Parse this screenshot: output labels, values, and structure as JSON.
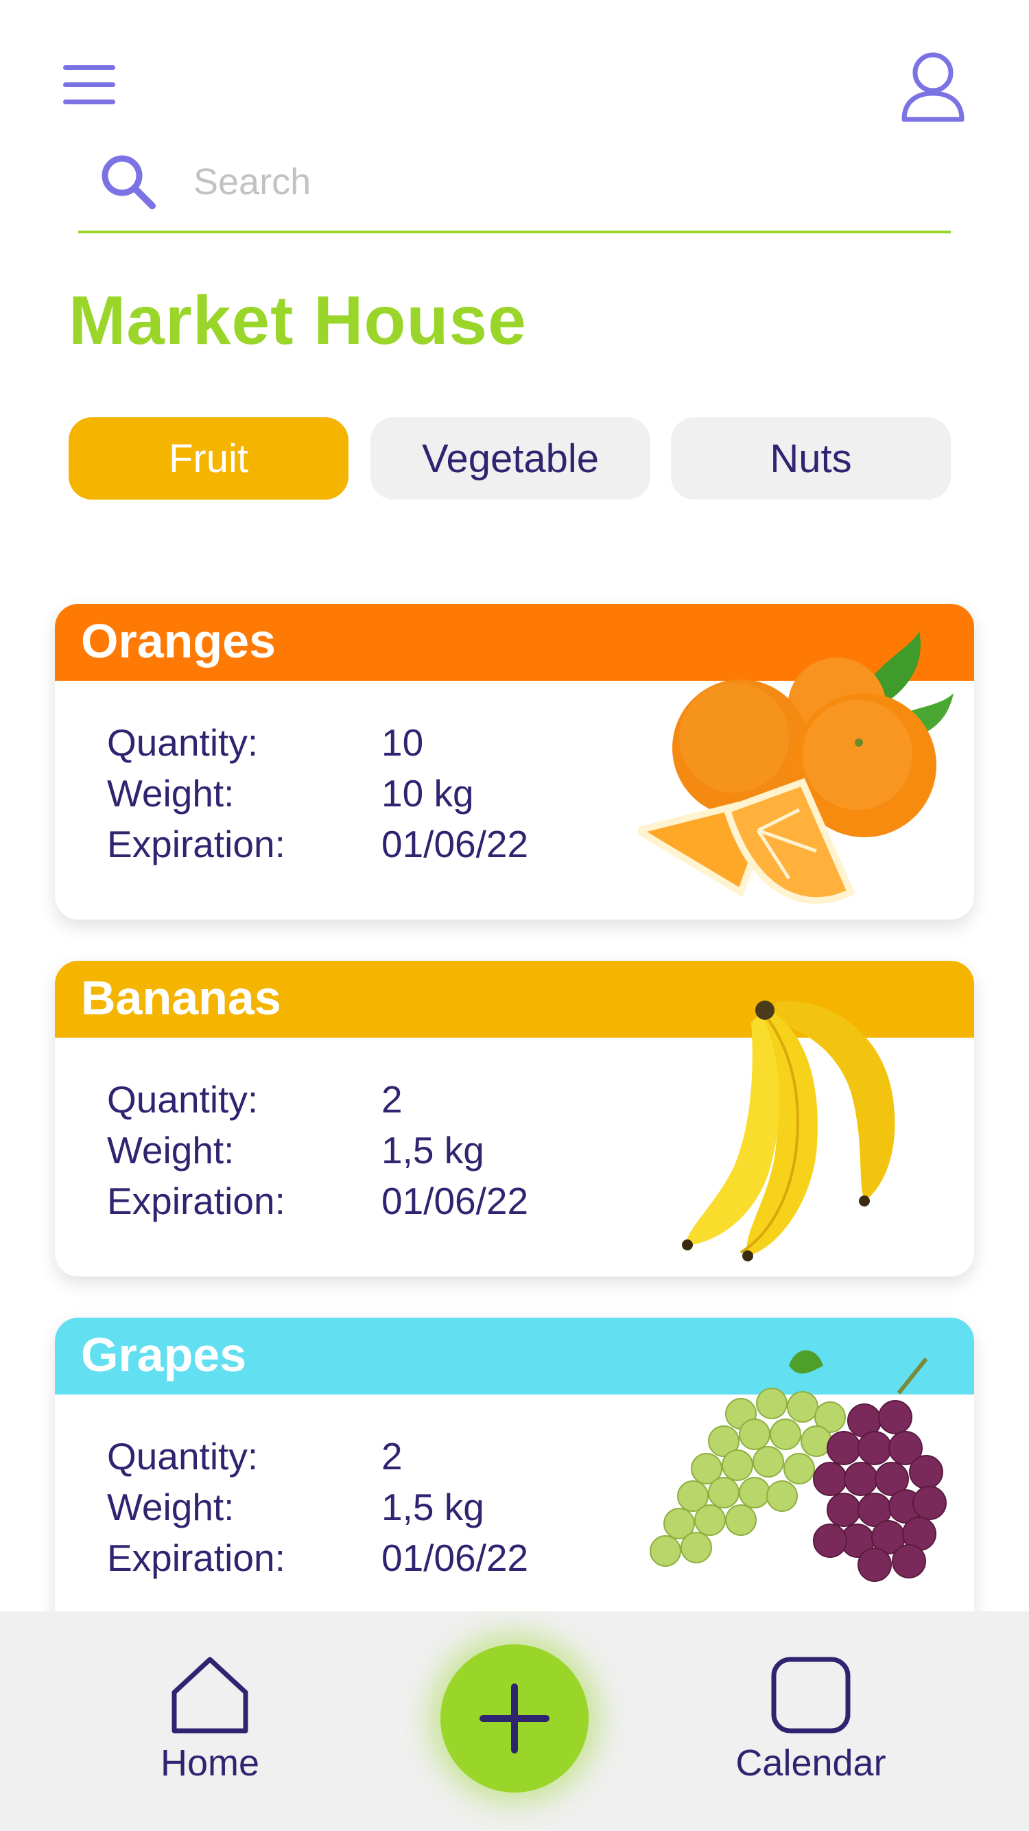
{
  "search": {
    "placeholder": "Search"
  },
  "page_title": "Market House",
  "tabs": [
    {
      "label": "Fruit",
      "active": true
    },
    {
      "label": "Vegetable",
      "active": false
    },
    {
      "label": "Nuts",
      "active": false
    }
  ],
  "products": [
    {
      "name": "Oranges",
      "header_color": "#ff7a05",
      "image_icon": "oranges-image",
      "quantity_label": "Quantity:",
      "quantity": "10",
      "weight_label": "Weight:",
      "weight": "10 kg",
      "expiration_label": "Expiration:",
      "expiration": "01/06/22"
    },
    {
      "name": "Bananas",
      "header_color": "#f4b400",
      "image_icon": "bananas-image",
      "quantity_label": "Quantity:",
      "quantity": "2",
      "weight_label": "Weight:",
      "weight": "1,5 kg",
      "expiration_label": "Expiration:",
      "expiration": "01/06/22"
    },
    {
      "name": "Grapes",
      "header_color": "#62dff0",
      "image_icon": "grapes-image",
      "quantity_label": "Quantity:",
      "quantity": "2",
      "weight_label": "Weight:",
      "weight": "1,5 kg",
      "expiration_label": "Expiration:",
      "expiration": "01/06/22"
    }
  ],
  "bottom_nav": {
    "home_label": "Home",
    "calendar_label": "Calendar"
  },
  "colors": {
    "accent_green": "#9ad52a",
    "tab_active": "#f4b400",
    "text_navy": "#2e2470",
    "icon_purple": "#7b72e4"
  }
}
